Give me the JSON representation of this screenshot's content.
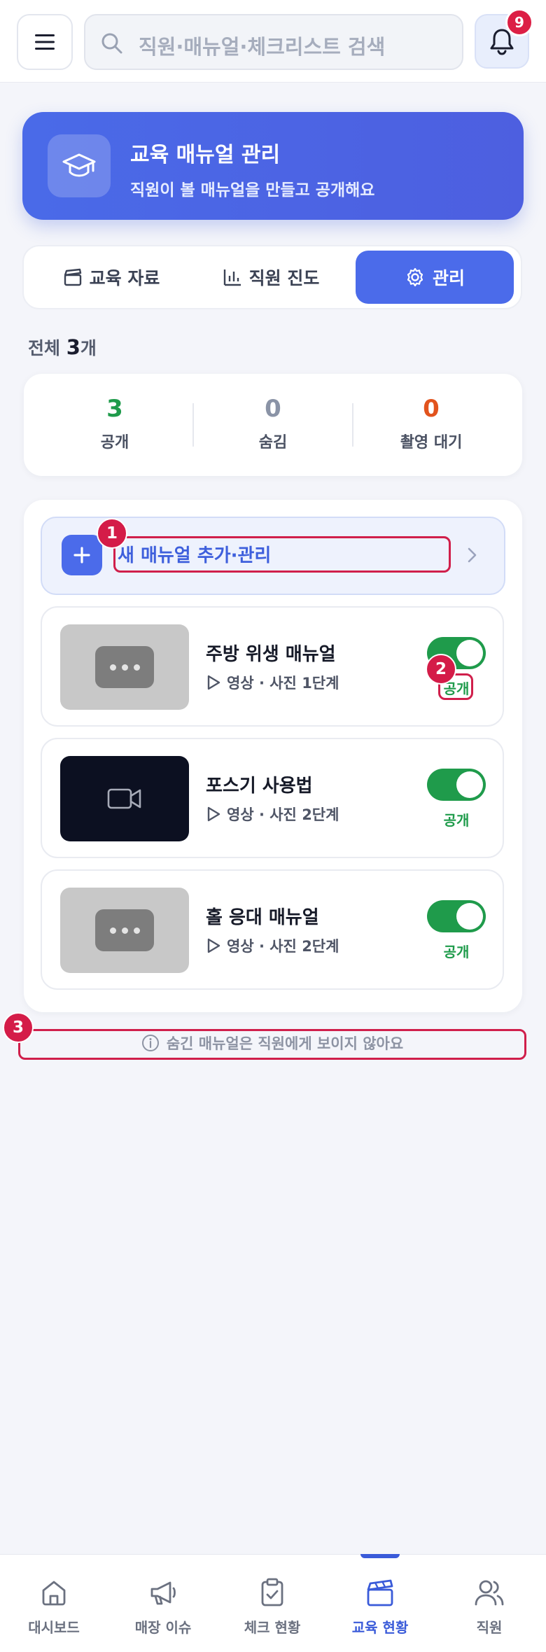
{
  "header": {
    "search_placeholder": "직원·매뉴얼·체크리스트 검색",
    "notification_count": "9"
  },
  "hero": {
    "title": "교육 매뉴얼 관리",
    "subtitle": "직원이 볼 매뉴얼을 만들고 공개해요"
  },
  "tabs": [
    {
      "label": "교육 자료",
      "icon": "clapperboard-icon",
      "active": false
    },
    {
      "label": "직원 진도",
      "icon": "bar-chart-icon",
      "active": false
    },
    {
      "label": "관리",
      "icon": "gear-icon",
      "active": true
    }
  ],
  "summary": {
    "total_prefix": "전체",
    "total_count": "3",
    "total_suffix": "개"
  },
  "stats": [
    {
      "value": "3",
      "label": "공개",
      "color": "#1f9b4b"
    },
    {
      "value": "0",
      "label": "숨김",
      "color": "#8a93a6"
    },
    {
      "value": "0",
      "label": "촬영 대기",
      "color": "#e2531d"
    }
  ],
  "add_row": {
    "label": "새 매뉴얼 추가·관리"
  },
  "manuals": [
    {
      "title": "주방 위생 매뉴얼",
      "meta": "영상 · 사진 1단계",
      "thumb": "placeholder-dots",
      "published": true,
      "status": "공개"
    },
    {
      "title": "포스기 사용법",
      "meta": "영상 · 사진 2단계",
      "thumb": "video-camera",
      "published": true,
      "status": "공개"
    },
    {
      "title": "홀 응대 매뉴얼",
      "meta": "영상 · 사진 2단계",
      "thumb": "placeholder-dots",
      "published": true,
      "status": "공개"
    }
  ],
  "notice": "숨긴 매뉴얼은 직원에게 보이지 않아요",
  "annotations": [
    "1",
    "2",
    "3"
  ],
  "bottom_nav": [
    {
      "label": "대시보드",
      "icon": "home-icon",
      "active": false
    },
    {
      "label": "매장 이슈",
      "icon": "megaphone-icon",
      "active": false
    },
    {
      "label": "체크 현황",
      "icon": "clipboard-check-icon",
      "active": false
    },
    {
      "label": "교육 현황",
      "icon": "clapperboard-icon",
      "active": true
    },
    {
      "label": "직원",
      "icon": "users-icon",
      "active": false
    }
  ],
  "colors": {
    "accent": "#4b6bea",
    "published": "#1f9b4b",
    "annotation": "#d01f4b"
  }
}
